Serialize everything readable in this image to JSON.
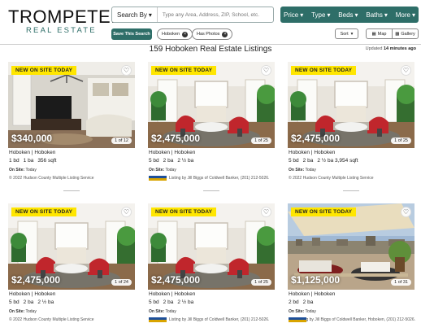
{
  "header": {
    "logo_main": "TROMPETER",
    "logo_sub": "REAL ESTATE",
    "search_by_label": "Search By",
    "search_placeholder": "Type any Area, Address, ZIP, School, etc.",
    "filters": [
      "Price",
      "Type",
      "Beds",
      "Baths",
      "More"
    ],
    "save_search_label": "Save This Search",
    "chips": [
      "Hoboken",
      "Has Photos"
    ],
    "sort_label": "Sort",
    "view_map_label": "Map",
    "view_gallery_label": "Gallery"
  },
  "listing_header": {
    "title": "159 Hoboken Real Estate Listings",
    "updated_prefix": "Updated",
    "updated_value": "14 minutes ago"
  },
  "cards": [
    {
      "badge": "NEW ON SITE TODAY",
      "price": "$340,000",
      "counter": "1 of 12",
      "location": "Hoboken | Hoboken",
      "beds": "1 bd",
      "baths": "1 ba",
      "extra": "356 sqft",
      "onsite_label": "On Site:",
      "onsite_value": "Today",
      "credit": "© 2022 Hudson County Multiple Listing Service",
      "show_mls": false,
      "photo": "apartment"
    },
    {
      "badge": "NEW ON SITE TODAY",
      "price": "$2,475,000",
      "counter": "1 of 25",
      "location": "Hoboken | Hoboken",
      "beds": "5 bd",
      "baths": "2 ba",
      "extra": "2 ½ ba",
      "onsite_label": "On Site:",
      "onsite_value": "Today",
      "credit": "Listing by Jill Biggs of Coldwell Banker, (201) 212-5026.",
      "show_mls": true,
      "photo": "living"
    },
    {
      "badge": "NEW ON SITE TODAY",
      "price": "$2,475,000",
      "counter": "1 of 25",
      "location": "Hoboken | Hoboken",
      "beds": "5 bd",
      "baths": "2 ba",
      "extra": "2 ½ ba   3,954 sqft",
      "onsite_label": "On Site:",
      "onsite_value": "Today",
      "credit": "© 2022 Hudson County Multiple Listing Service",
      "show_mls": false,
      "photo": "living"
    },
    {
      "badge": "NEW ON SITE TODAY",
      "price": "$2,475,000",
      "counter": "1 of 24",
      "location": "Hoboken | Hoboken",
      "beds": "5 bd",
      "baths": "2 ba",
      "extra": "2 ½ ba",
      "onsite_label": "On Site:",
      "onsite_value": "Today",
      "credit": "© 2022 Hudson County Multiple Listing Service",
      "show_mls": false,
      "photo": "living"
    },
    {
      "badge": "NEW ON SITE TODAY",
      "price": "$2,475,000",
      "counter": "1 of 25",
      "location": "Hoboken | Hoboken",
      "beds": "5 bd",
      "baths": "2 ba",
      "extra": "2 ½ ba",
      "onsite_label": "On Site:",
      "onsite_value": "Today",
      "credit": "Listing by Jill Biggs of Coldwell Banker, (201) 212-5026.",
      "show_mls": true,
      "photo": "living"
    },
    {
      "badge": "NEW ON SITE TODAY",
      "price": "$1,125,000",
      "counter": "1 of 31",
      "location": "Hoboken | Hoboken",
      "beds": "2 bd",
      "baths": "2 ba",
      "extra": "",
      "onsite_label": "On Site:",
      "onsite_value": "Today",
      "credit": "Listing by Jill Biggs of Coldwell Banker, Hoboken, (201) 212-5026.",
      "show_mls": true,
      "photo": "terrace"
    }
  ],
  "colors": {
    "brand": "#2e6e68",
    "badge": "#ffe600"
  },
  "icons": {
    "heart": "heart-icon",
    "close": "close-icon",
    "chevron": "chevron-down-icon",
    "map": "map-icon",
    "gallery": "gallery-icon"
  }
}
